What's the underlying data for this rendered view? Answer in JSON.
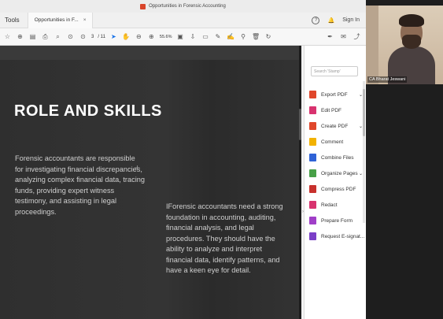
{
  "window": {
    "title": "Opportunities in Forensic Accounting"
  },
  "tabbar": {
    "tools_label": "Tools",
    "doc_tab_label": "Opportunities in F...",
    "close_glyph": "×",
    "sign_in": "Sign In"
  },
  "toolbar": {
    "page_current": "3",
    "page_total": "/ 11",
    "zoom": "55.6%"
  },
  "slide": {
    "heading": "ROLE AND SKILLS",
    "paragraph1": "Forensic accountants are responsible for investigating financial discrepancies, analyzing complex financial data, tracing funds, providing expert witness testimony, and assisting in legal proceedings.",
    "paragraph2": "IForensic accountants need a strong foundation in accounting, auditing, financial analysis, and legal procedures. They should have the ability to analyze and interpret financial data, identify patterns, and have a keen eye for detail."
  },
  "right_panel": {
    "search_placeholder": "Search 'Stamp'",
    "tools": [
      {
        "label": "Export PDF",
        "has_chevron": true,
        "color": "#e0472b"
      },
      {
        "label": "Edit PDF",
        "has_chevron": false,
        "color": "#d8336f"
      },
      {
        "label": "Create PDF",
        "has_chevron": true,
        "color": "#e0472b"
      },
      {
        "label": "Comment",
        "has_chevron": false,
        "color": "#f2b200"
      },
      {
        "label": "Combine Files",
        "has_chevron": false,
        "color": "#2f63d6"
      },
      {
        "label": "Organize Pages",
        "has_chevron": true,
        "color": "#47a047"
      },
      {
        "label": "Compress PDF",
        "has_chevron": false,
        "color": "#c8312d"
      },
      {
        "label": "Redact",
        "has_chevron": false,
        "color": "#d8336f"
      },
      {
        "label": "Prepare Form",
        "has_chevron": false,
        "color": "#a03fc8"
      },
      {
        "label": "Request E-signat...",
        "has_chevron": false,
        "color": "#7b3fc8"
      }
    ],
    "chevron_glyph": "⌄"
  },
  "presenter": {
    "name": "CA Bharat Jeswani"
  }
}
